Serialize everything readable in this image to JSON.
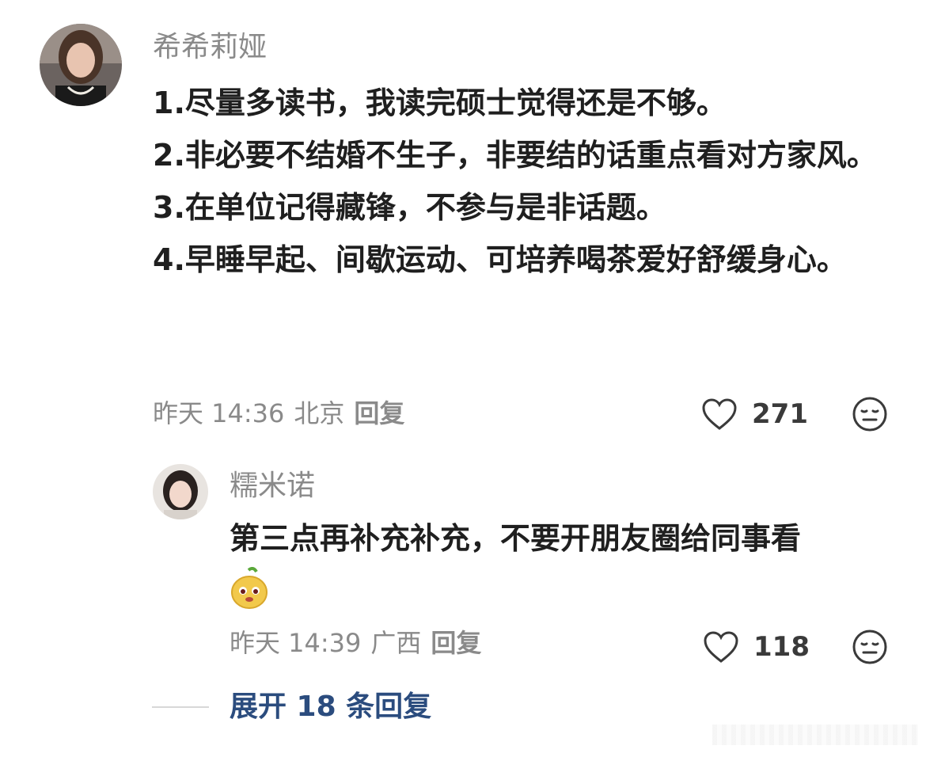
{
  "comments": [
    {
      "username": "希希莉娅",
      "lines": [
        "1.尽量多读书，我读完硕士觉得还是不够。",
        "2.非必要不结婚不生子，非要结的话重点看对方家风。",
        "3.在单位记得藏锋，不参与是非话题。",
        "4.早睡早起、间歇运动、可培养喝茶爱好舒缓身心。"
      ],
      "time": "昨天 14:36",
      "location": "北京",
      "reply_label": "回复",
      "likes": "271",
      "like_icon": "heart-icon",
      "reaction_icon": "expressionless-face-icon"
    },
    {
      "username": "糯米诺",
      "text": "第三点再补充补充，不要开朋友圈给同事看",
      "emoji": "yellow-blob-emoji",
      "time": "昨天 14:39",
      "location": "广西",
      "reply_label": "回复",
      "likes": "118",
      "like_icon": "heart-icon",
      "reaction_icon": "expressionless-face-icon"
    }
  ],
  "expand_label": "展开 18 条回复",
  "colors": {
    "username": "#8a8a8a",
    "text": "#1f1f1f",
    "meta": "#8a8a8a",
    "expand": "#2b4c7e"
  }
}
